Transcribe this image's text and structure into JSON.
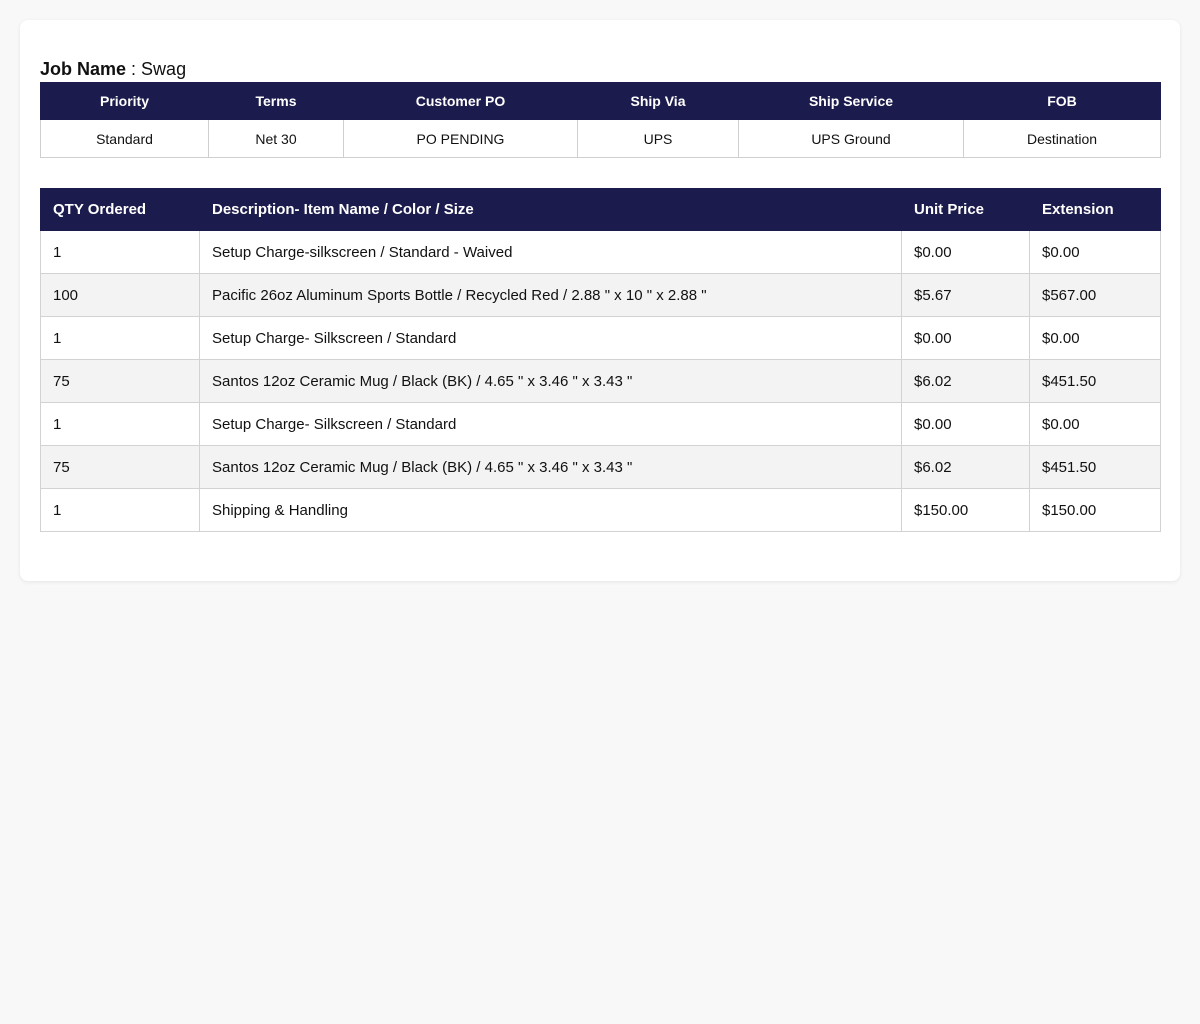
{
  "job": {
    "label": "Job Name",
    "separator": " : ",
    "value": "Swag"
  },
  "summary": {
    "headers": {
      "priority": "Priority",
      "terms": "Terms",
      "customer_po": "Customer PO",
      "ship_via": "Ship Via",
      "ship_service": "Ship Service",
      "fob": "FOB"
    },
    "values": {
      "priority": "Standard",
      "terms": "Net 30",
      "customer_po": "PO PENDING",
      "ship_via": "UPS",
      "ship_service": "UPS Ground",
      "fob": "Destination"
    }
  },
  "items": {
    "headers": {
      "qty": "QTY Ordered",
      "description": "Description- Item Name / Color / Size",
      "unit_price": "Unit Price",
      "extension": "Extension"
    },
    "rows": [
      {
        "qty": "1",
        "description": "Setup Charge-silkscreen / Standard - Waived",
        "unit_price": "$0.00",
        "extension": "$0.00"
      },
      {
        "qty": "100",
        "description": "Pacific 26oz Aluminum Sports Bottle / Recycled Red / 2.88 \" x 10 \" x 2.88 \"",
        "unit_price": "$5.67",
        "extension": "$567.00"
      },
      {
        "qty": "1",
        "description": "Setup Charge- Silkscreen / Standard",
        "unit_price": "$0.00",
        "extension": "$0.00"
      },
      {
        "qty": "75",
        "description": "Santos 12oz Ceramic Mug / Black (BK) / 4.65 \" x 3.46 \" x 3.43 \"",
        "unit_price": "$6.02",
        "extension": "$451.50"
      },
      {
        "qty": "1",
        "description": "Setup Charge- Silkscreen / Standard",
        "unit_price": "$0.00",
        "extension": "$0.00"
      },
      {
        "qty": "75",
        "description": "Santos 12oz Ceramic Mug / Black (BK) / 4.65 \" x 3.46 \" x 3.43 \"",
        "unit_price": "$6.02",
        "extension": "$451.50"
      },
      {
        "qty": "1",
        "description": "Shipping & Handling",
        "unit_price": "$150.00",
        "extension": "$150.00"
      }
    ]
  },
  "colors": {
    "header_bg": "#1c1b4d",
    "header_text": "#ffffff",
    "alt_row_bg": "#f3f3f3",
    "page_bg": "#f8f8f8"
  }
}
